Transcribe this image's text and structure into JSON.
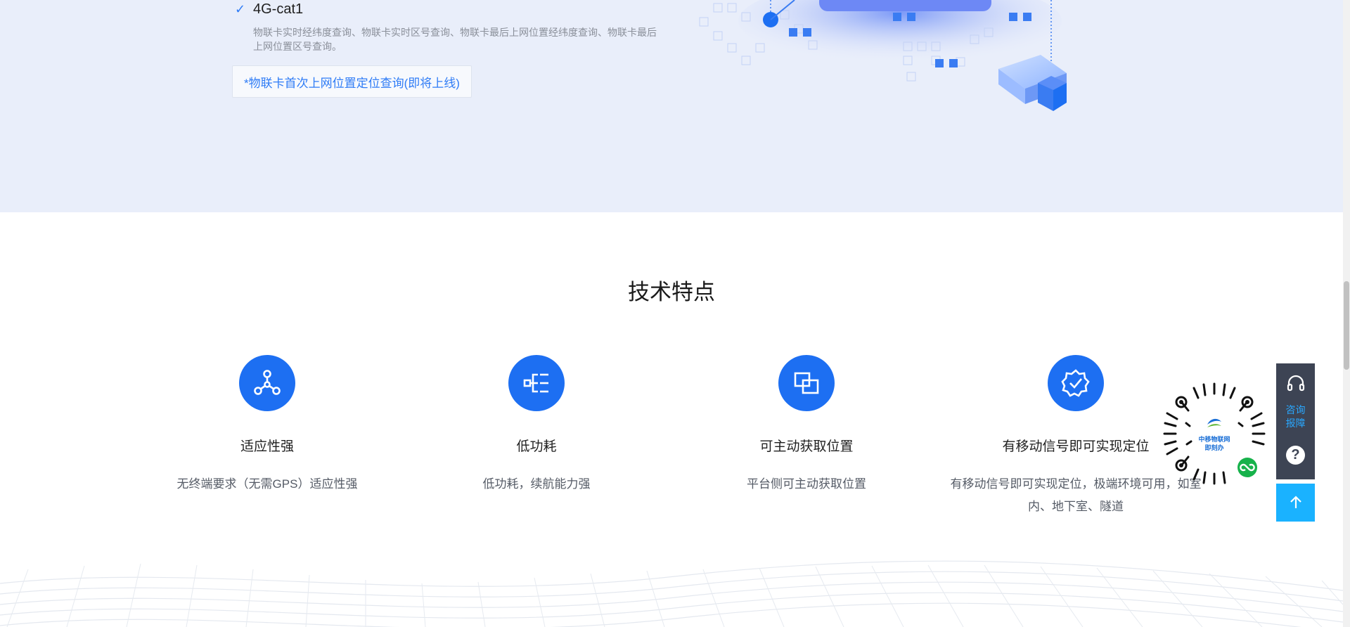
{
  "feature": {
    "title": "4G-cat1",
    "description": "物联卡实时经纬度查询、物联卡实时区号查询、物联卡最后上网位置经纬度查询、物联卡最后上网位置区号查询。",
    "coming_soon": "*物联卡首次上网位置定位查询(即将上线)"
  },
  "tech": {
    "title": "技术特点",
    "items": [
      {
        "name": "适应性强",
        "desc": "无终端要求（无需GPS）适应性强",
        "icon": "network-icon"
      },
      {
        "name": "低功耗",
        "desc": "低功耗，续航能力强",
        "icon": "data-flow-icon"
      },
      {
        "name": "可主动获取位置",
        "desc": "平台侧可主动获取位置",
        "icon": "overlap-squares-icon"
      },
      {
        "name": "有移动信号即可实现定位",
        "desc": "有移动信号即可实现定位，极端环境可用，如室内、地下室、隧道",
        "icon": "verified-badge-icon"
      }
    ]
  },
  "float_panel": {
    "consult_label": "咨询报障",
    "help_symbol": "?"
  },
  "qr": {
    "logo_line1": "中移物联网",
    "logo_line2": "即刻办"
  },
  "colors": {
    "accent": "#1d6ff2",
    "link_blue": "#2f7cf6",
    "band_bg": "#e9eefa",
    "panel_bg": "#3d4454",
    "top_button": "#1ab2ff"
  }
}
